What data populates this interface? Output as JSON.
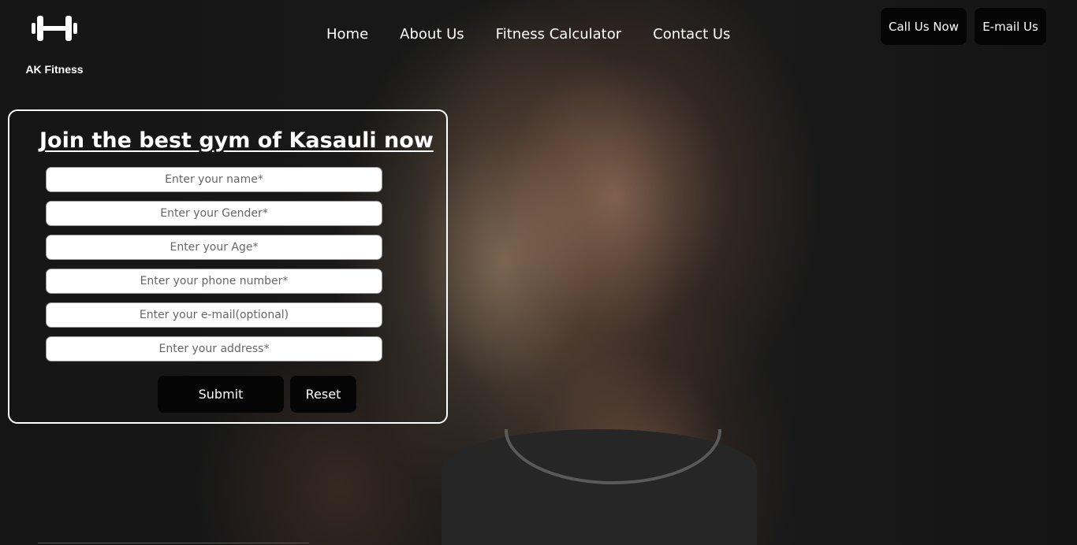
{
  "brand": {
    "name": "AK Fitness",
    "icon": "dumbbell-icon"
  },
  "nav": {
    "items": [
      {
        "label": "Home"
      },
      {
        "label": "About Us"
      },
      {
        "label": "Fitness Calculator"
      },
      {
        "label": "Contact Us"
      }
    ]
  },
  "header_buttons": {
    "call": "Call Us Now",
    "email": "E-mail Us"
  },
  "form": {
    "title": "Join the best gym of Kasauli now",
    "fields": {
      "name": {
        "placeholder": "Enter your name*",
        "value": ""
      },
      "gender": {
        "placeholder": "Enter your Gender*",
        "value": ""
      },
      "age": {
        "placeholder": "Enter your Age*",
        "value": ""
      },
      "phone": {
        "placeholder": "Enter your phone number*",
        "value": ""
      },
      "email": {
        "placeholder": "Enter your e-mail(optional)",
        "value": ""
      },
      "address": {
        "placeholder": "Enter your address*",
        "value": ""
      }
    },
    "submit_label": "Submit",
    "reset_label": "Reset"
  },
  "colors": {
    "background": "#131313",
    "button": "#050505",
    "text": "#ffffff"
  }
}
